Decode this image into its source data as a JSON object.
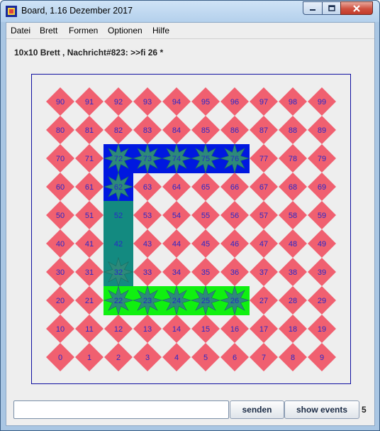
{
  "window": {
    "title": "Board, 1.16 Dezember 2017"
  },
  "menu": [
    "Datei",
    "Brett",
    "Formen",
    "Optionen",
    "Hilfe"
  ],
  "status": "10x10 Brett , Nachricht#823: >>fi 26 *",
  "board": {
    "rows": 10,
    "cols": 10,
    "cell_color": "#f06070",
    "number_color": "#2828c8",
    "backgrounds": [
      {
        "cells": [
          72,
          73,
          74,
          75,
          76,
          62
        ],
        "color": "#0018e0"
      },
      {
        "cells": [
          52,
          42,
          32
        ],
        "color": "#138a80"
      },
      {
        "cells": [
          22,
          23,
          24,
          25,
          26
        ],
        "color": "#10f010"
      }
    ],
    "stars": [
      72,
      73,
      74,
      75,
      76,
      62,
      32,
      22,
      23,
      24,
      25,
      26
    ],
    "hidden_diamonds": [
      72,
      73,
      74,
      75,
      76,
      62,
      52,
      42,
      32,
      22,
      23,
      24,
      25,
      26
    ],
    "star_fill": "#2d8a7a",
    "star_center_fill": "#2e9a8a"
  },
  "input": {
    "value": ""
  },
  "buttons": {
    "send": "senden",
    "events": "show events"
  },
  "event_count": "5"
}
